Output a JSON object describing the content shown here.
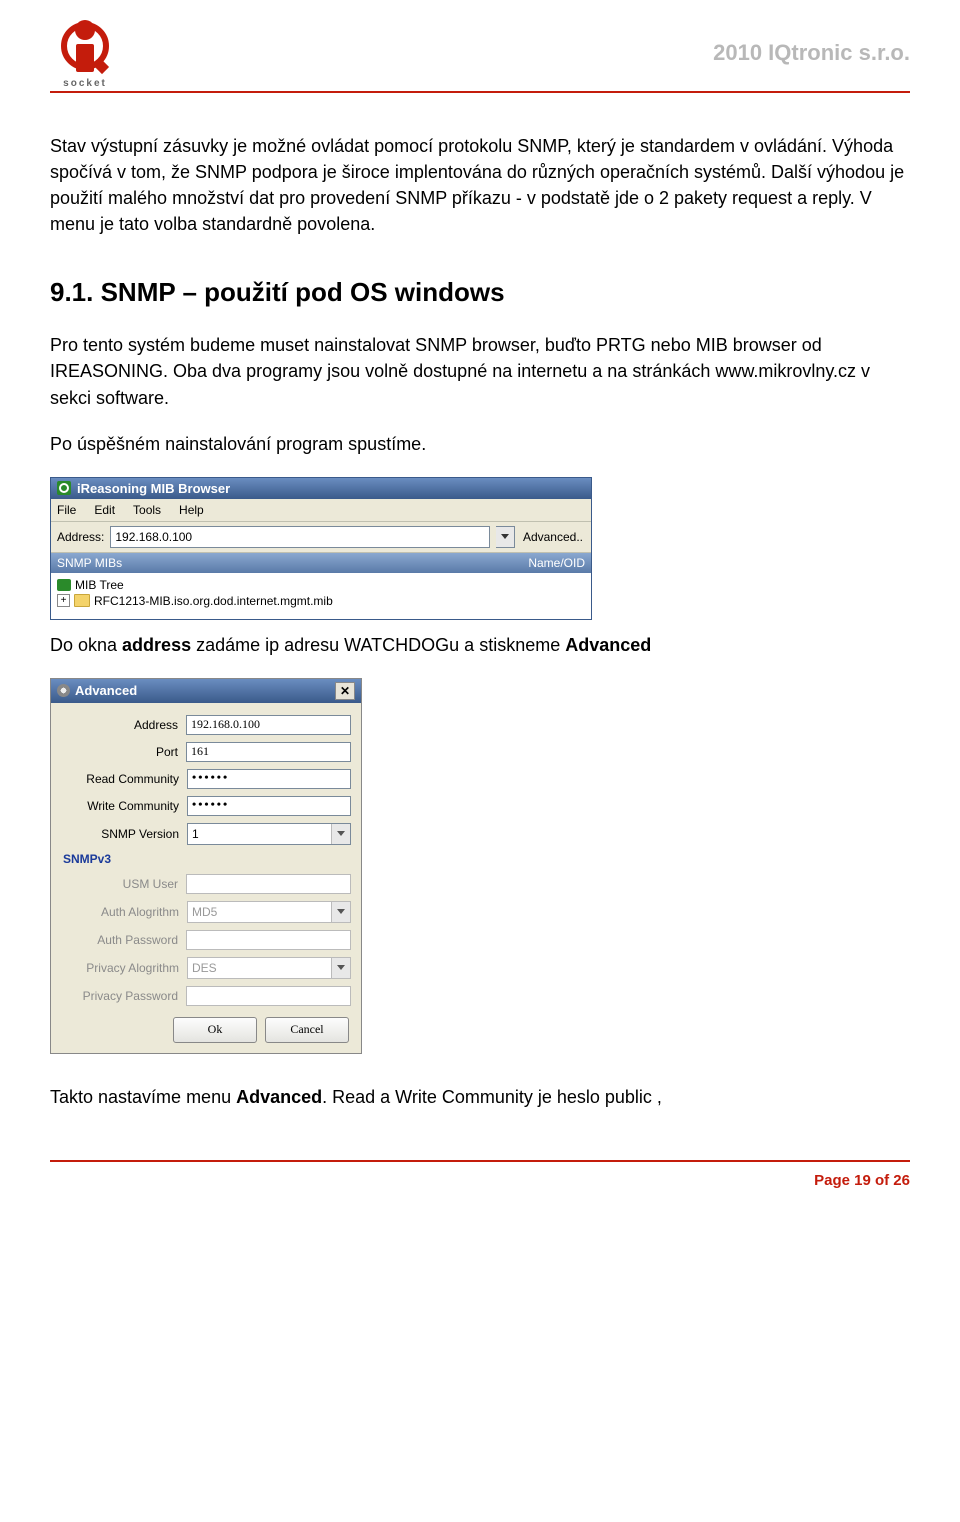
{
  "header": {
    "logo_text": "socket",
    "company": "2010 IQtronic  s.r.o."
  },
  "body": {
    "para1": "Stav výstupní zásuvky je možné  ovládat pomocí protokolu SNMP, který je standardem v ovládání. Výhoda spočívá v tom, že SNMP podpora je široce implentována do různých operačních systémů. Další výhodou je použití malého množství dat pro provedení SNMP příkazu - v podstatě jde o 2 pakety request a reply. V menu je tato volba standardně povolena.",
    "h2": "9.1. SNMP – použití pod OS windows",
    "para2": "Pro tento systém budeme muset nainstalovat SNMP browser, buďto PRTG nebo MIB browser od IREASONING. Oba dva programy jsou volně dostupné na internetu a na stránkách www.mikrovlny.cz v sekci software.",
    "para3": "Po úspěšném nainstalování program spustíme.",
    "para4_pre": "Do okna ",
    "para4_b1": "address",
    "para4_mid": " zadáme ip adresu WATCHDOGu a stiskneme ",
    "para4_b2": "Advanced",
    "para5_pre": "Takto nastavíme menu ",
    "para5_b1": "Advanced",
    "para5_post": ". Read a Write Community je heslo public ,"
  },
  "mib": {
    "title": "iReasoning MIB Browser",
    "menu": {
      "file": "File",
      "edit": "Edit",
      "tools": "Tools",
      "help": "Help"
    },
    "address_label": "Address:",
    "address_value": "192.168.0.100",
    "advanced": "Advanced..",
    "subhead_left": "SNMP MIBs",
    "subhead_right": "Name/OID",
    "tree_root": "MIB Tree",
    "tree_node": "RFC1213-MIB.iso.org.dod.internet.mgmt.mib"
  },
  "adv": {
    "title": "Advanced",
    "labels": {
      "address": "Address",
      "port": "Port",
      "read": "Read Community",
      "write": "Write Community",
      "version": "SNMP Version",
      "section": "SNMPv3",
      "usm": "USM User",
      "auth_alg": "Auth Alogrithm",
      "auth_pw": "Auth Password",
      "priv_alg": "Privacy Alogrithm",
      "priv_pw": "Privacy Password"
    },
    "values": {
      "address": "192.168.0.100",
      "port": "161",
      "read": "••••••",
      "write": "••••••",
      "version": "1",
      "usm": "",
      "auth_alg": "MD5",
      "auth_pw": "",
      "priv_alg": "DES",
      "priv_pw": ""
    },
    "buttons": {
      "ok": "Ok",
      "cancel": "Cancel"
    }
  },
  "footer": {
    "page": "Page 19 of 26"
  }
}
